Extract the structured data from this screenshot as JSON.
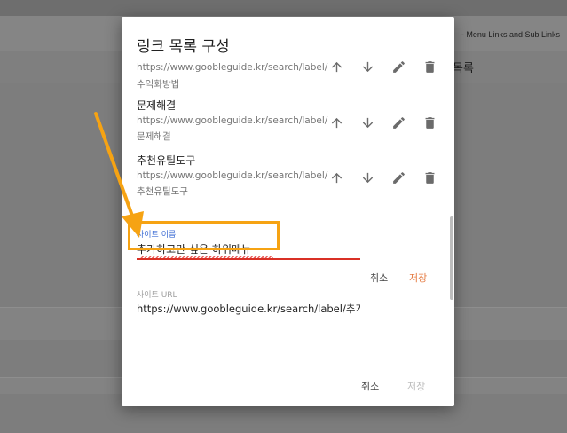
{
  "background": {
    "header_text": "- Menu Links and Sub Links",
    "item_text": "목록"
  },
  "dialog": {
    "title": "링크 목록 구성",
    "items": [
      {
        "name": "",
        "url": "https://www.goobleguide.kr/search/label/",
        "label": "수익화방법"
      },
      {
        "name": "문제해결",
        "url": "https://www.goobleguide.kr/search/label/",
        "label": "문제해결"
      },
      {
        "name": "추천유틸도구",
        "url": "https://www.goobleguide.kr/search/label/",
        "label": "추천유틸도구"
      }
    ],
    "form": {
      "site_name_label": "사이트 이름",
      "site_name_value": "추가하고만 싶은 하위메뉴",
      "cancel_label": "취소",
      "save_label": "저장",
      "site_url_label": "사이트 URL",
      "site_url_value": "https://www.goobleguide.kr/search/label/추가"
    },
    "footer": {
      "cancel_label": "취소",
      "save_label": "저장"
    }
  },
  "icons": {
    "move_up": "arrow-up-icon",
    "move_down": "arrow-down-icon",
    "edit": "pencil-icon",
    "delete": "trash-icon"
  },
  "colors": {
    "annotation": "#f6a313",
    "error_underline": "#d93025",
    "save_accent": "#e57c43",
    "focused_label": "#3f6ed4"
  }
}
